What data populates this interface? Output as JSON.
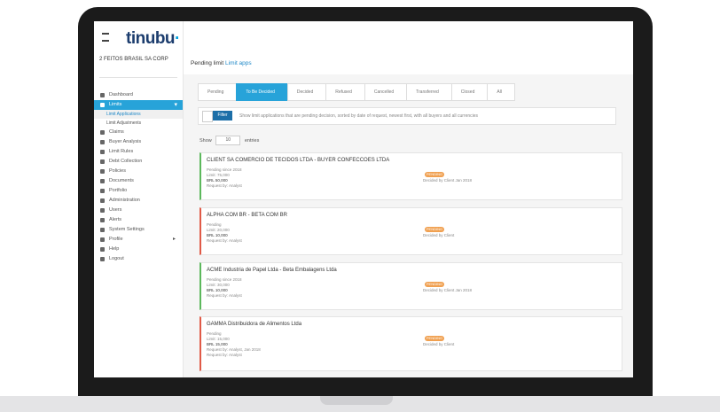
{
  "app": {
    "logo": "tinubu",
    "company": "2 FEITOS BRASIL SA CORP"
  },
  "sidebar": {
    "items": [
      {
        "label": "Dashboard",
        "icon": "home-icon"
      },
      {
        "label": "Limits",
        "icon": "list-icon",
        "active": true
      },
      {
        "label": "Claims",
        "icon": "flag-icon"
      },
      {
        "label": "Buyer Analysis",
        "icon": "chart-icon"
      },
      {
        "label": "Limit Rules",
        "icon": "rules-icon"
      },
      {
        "label": "Debt Collection",
        "icon": "collection-icon"
      },
      {
        "label": "Policies",
        "icon": "policy-icon"
      },
      {
        "label": "Documents",
        "icon": "document-icon"
      },
      {
        "label": "Portfolio",
        "icon": "portfolio-icon"
      },
      {
        "label": "Administration",
        "icon": "admin-icon"
      },
      {
        "label": "Users",
        "icon": "users-icon"
      },
      {
        "label": "Alerts",
        "icon": "alert-icon"
      },
      {
        "label": "System Settings",
        "icon": "settings-icon"
      },
      {
        "label": "Profile",
        "icon": "profile-icon",
        "right": "▸"
      },
      {
        "label": "Help",
        "icon": "help-icon"
      },
      {
        "label": "Logout",
        "icon": "logout-icon"
      }
    ],
    "subitems": [
      {
        "label": "Limit Applications"
      },
      {
        "label": "Limit Adjustments"
      }
    ]
  },
  "breadcrumb": {
    "prefix": "Pending limit",
    "link": "Limit apps"
  },
  "steps": [
    "Pending",
    "To Be Decided",
    "Decided",
    "Refused",
    "Cancelled",
    "Transferred",
    "Closed",
    "All"
  ],
  "filter": {
    "btn": "Filter",
    "text": "Show limit applications that are pending decision, sorted by date of request, newest first, with all buyers and all currencies"
  },
  "show": {
    "prefix": "Show",
    "value": "10",
    "suffix": "entries"
  },
  "cards": [
    {
      "title": "CLIENT SA COMERCIO DE TECIDOS LTDA - BUYER CONFECCOES LTDA",
      "lines": [
        "Pending since 2018",
        "Limit: 75,000",
        "BRL 50,000",
        "Request by: Analyst"
      ],
      "badge": "PENDING",
      "sub": "Decided by Client Jan 2018",
      "red": false
    },
    {
      "title": "ALPHA COM BR - BETA COM BR",
      "lines": [
        "Pending",
        "Limit: 20,000",
        "BRL 10,000",
        "Request by: Analyst"
      ],
      "badge": "PENDING",
      "sub": "Decided by Client",
      "red": true
    },
    {
      "title": "ACME Industria de Papel Ltda - Beta Embalagens Ltda",
      "lines": [
        "Pending since 2018",
        "Limit: 30,000",
        "BRL 10,000",
        "Request by: Analyst"
      ],
      "badge": "PENDING",
      "sub": "Decided by Client Jan 2018",
      "red": false
    },
    {
      "title": "GAMMA Distribuidora de Alimentos Ltda",
      "lines": [
        "Pending",
        "Limit: 15,000",
        "BRL 15,000",
        "Request by: Analyst, Jan 2018",
        "Request by: Analyst"
      ],
      "badge": "PENDING",
      "sub": "Decided by Client",
      "red": true
    }
  ],
  "colors": {
    "accent": "#27a3d9",
    "frame": "#1b1b1b",
    "green": "#5cb85c",
    "red": "#e05a47",
    "orange": "#f0a050"
  }
}
